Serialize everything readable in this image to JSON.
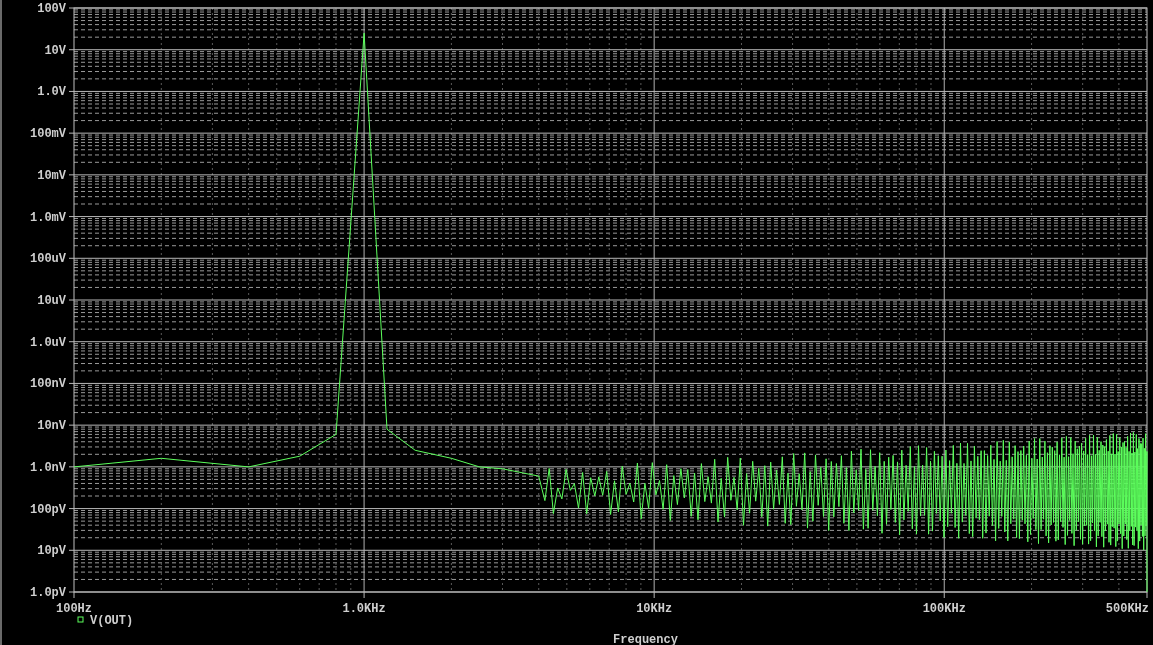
{
  "plot": {
    "y_axis_labels": [
      "100V",
      "10V",
      "1.0V",
      "100mV",
      "10mV",
      "1.0mV",
      "100uV",
      "10uV",
      "1.0uV",
      "100nV",
      "10nV",
      "1.0nV",
      "100pV",
      "10pV",
      "1.0pV"
    ],
    "x_axis_labels": [
      "100Hz",
      "1.0KHz",
      "10KHz",
      "100KHz",
      "500KHz"
    ],
    "legend": [
      "V(OUT)"
    ],
    "x_axis_title": "Frequency"
  }
}
